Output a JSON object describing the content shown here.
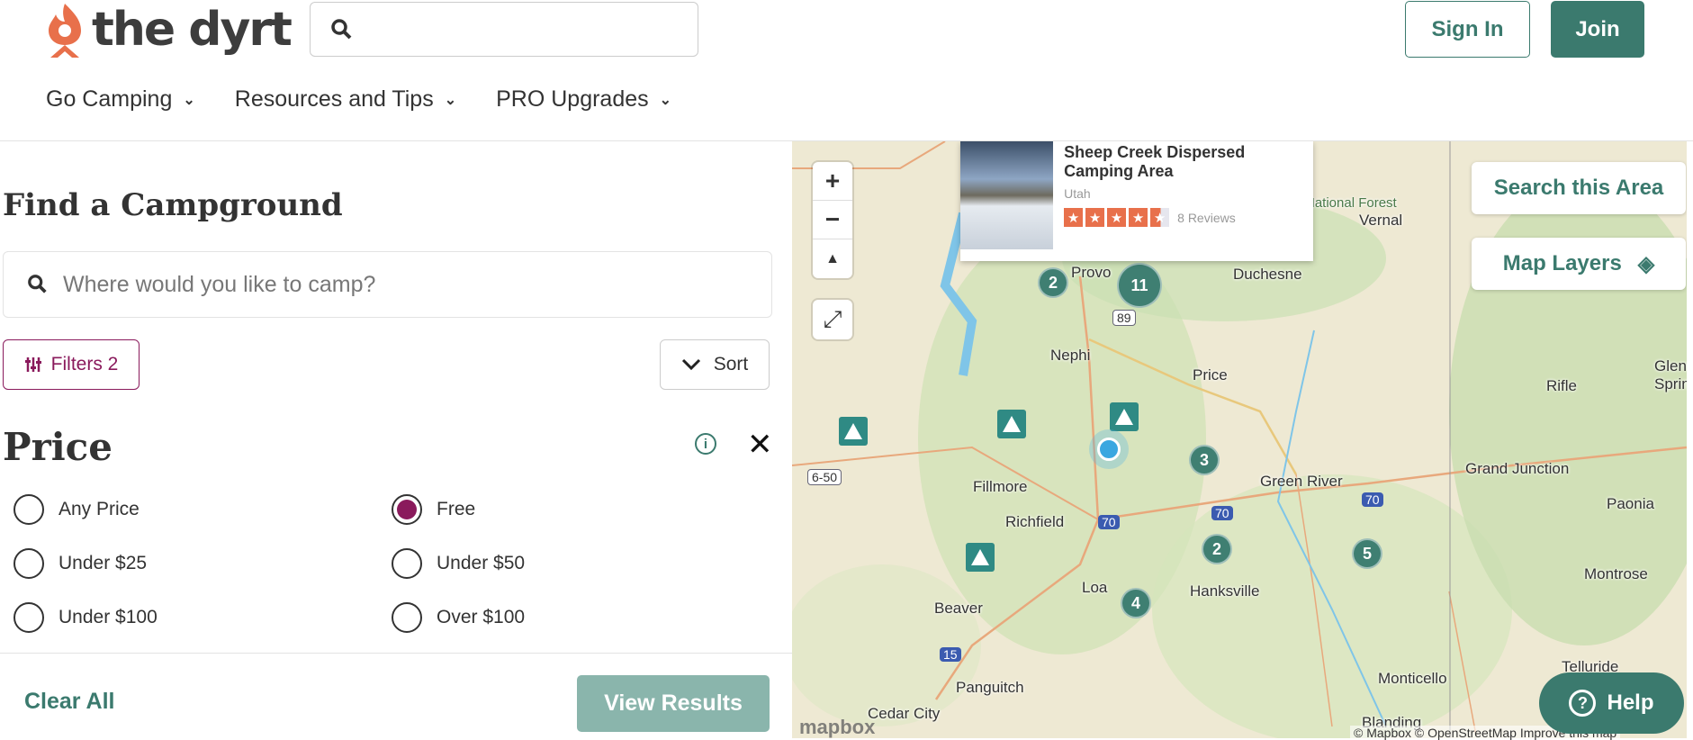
{
  "header": {
    "logo_text": "the dyrt",
    "search_value": "",
    "sign_in": "Sign In",
    "join": "Join"
  },
  "nav": [
    "Go Camping",
    "Resources and Tips",
    "PRO Upgrades"
  ],
  "panel": {
    "title": "Find a Campground",
    "location_placeholder": "Where would you like to camp?",
    "filters_label": "Filters 2",
    "sort_label": "Sort",
    "price_title": "Price",
    "price_options": [
      {
        "label": "Any Price",
        "selected": false
      },
      {
        "label": "Free",
        "selected": true
      },
      {
        "label": "Under $25",
        "selected": false
      },
      {
        "label": "Under $50",
        "selected": false
      },
      {
        "label": "Under $100",
        "selected": false
      },
      {
        "label": "Over $100",
        "selected": false
      }
    ],
    "clear_all": "Clear All",
    "view_results": "View Results"
  },
  "map": {
    "popup": {
      "name": "Sheep Creek Dispersed Camping Area",
      "state": "Utah",
      "rating": 4.5,
      "reviews": "8 Reviews"
    },
    "search_area": "Search this Area",
    "map_layers": "Map Layers",
    "clusters": [
      "2",
      "11",
      "3",
      "2",
      "5",
      "4"
    ],
    "places": [
      "Provo",
      "Duchesne",
      "Vernal",
      "Nephi",
      "Price",
      "Rifle",
      "Glenwood Springs",
      "Fillmore",
      "Green River",
      "Grand Junction",
      "Richfield",
      "Paonia",
      "Hanksville",
      "Loa",
      "Beaver",
      "Montrose",
      "Panguitch",
      "Monticello",
      "Telluride",
      "Cedar City",
      "Blanding",
      "National Forest"
    ],
    "highways": [
      "89",
      "6-50",
      "70",
      "70",
      "70",
      "15"
    ],
    "attribution": "© Mapbox © OpenStreetMap Improve this map",
    "mapbox_logo": "mapbox"
  },
  "help": "Help",
  "colors": {
    "brand": "#3b7a6e",
    "accent": "#8a1a5c",
    "logo": "#e8704b"
  }
}
